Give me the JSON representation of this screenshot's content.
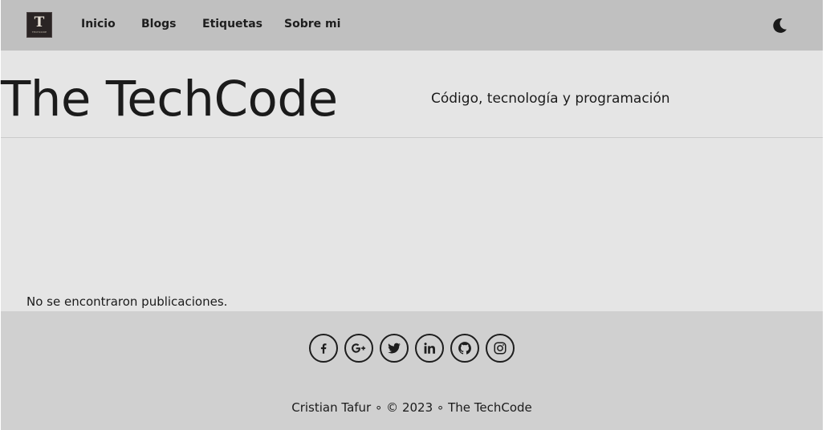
{
  "navbar": {
    "logo_text": "TECHCODE",
    "links": [
      "Inicio",
      "Blogs",
      "Etiquetas",
      "Sobre mi"
    ],
    "theme_toggle_icon": "moon-icon"
  },
  "hero": {
    "title": "The TechCode",
    "tagline": "Código, tecnología y programación"
  },
  "main": {
    "empty_message": "No se encontraron publicaciones."
  },
  "footer": {
    "social_icons": [
      "facebook-icon",
      "google-plus-icon",
      "twitter-icon",
      "linkedin-icon",
      "github-icon",
      "instagram-icon"
    ],
    "author": "Cristian Tafur",
    "separator": "∘",
    "copyright": "© 2023",
    "site_name": "The TechCode"
  },
  "colors": {
    "navbar_bg": "#c0c0c0",
    "page_bg": "#e5e5e5",
    "footer_bg": "#d0d0d0",
    "text": "#1b1b1b"
  }
}
